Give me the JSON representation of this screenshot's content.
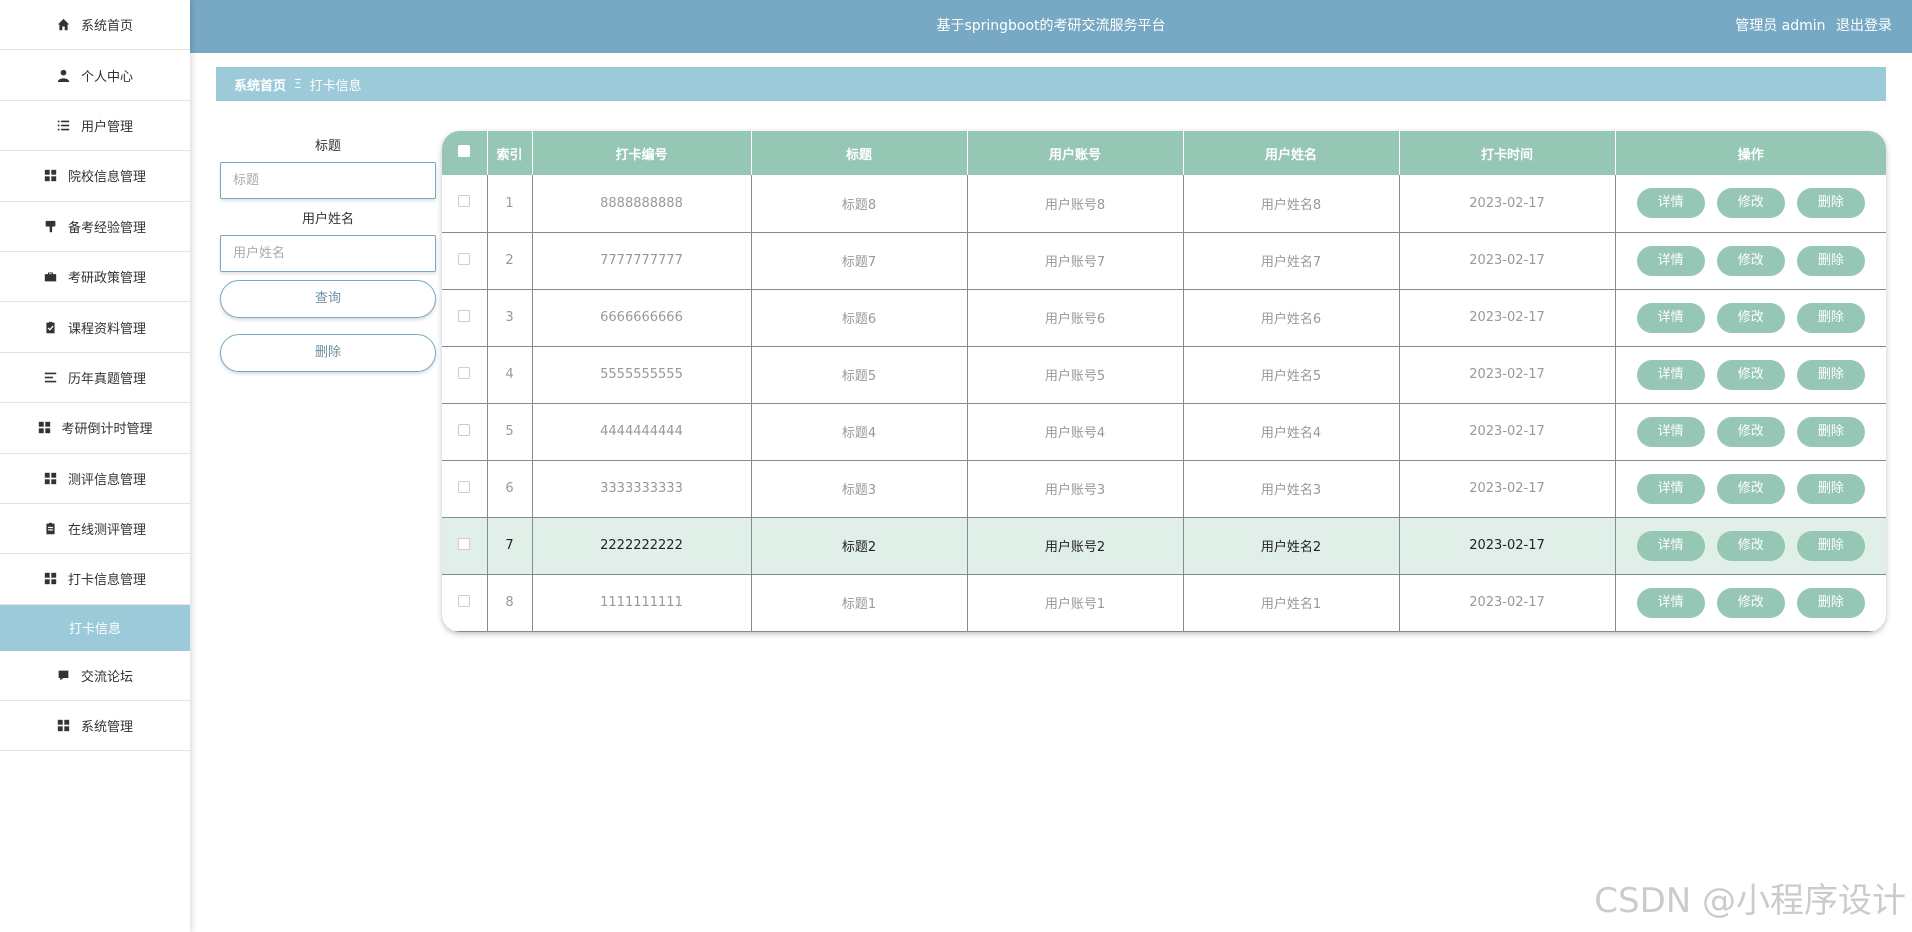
{
  "sidebar": {
    "items": [
      {
        "label": "系统首页",
        "icon": "home-icon"
      },
      {
        "label": "个人中心",
        "icon": "user-icon"
      },
      {
        "label": "用户管理",
        "icon": "list-icon"
      },
      {
        "label": "院校信息管理",
        "icon": "grid-icon"
      },
      {
        "label": "备考经验管理",
        "icon": "brush-icon"
      },
      {
        "label": "考研政策管理",
        "icon": "briefcase-icon"
      },
      {
        "label": "课程资料管理",
        "icon": "clipboard-check-icon"
      },
      {
        "label": "历年真题管理",
        "icon": "align-left-icon"
      },
      {
        "label": "考研倒计时管理",
        "icon": "grid-icon"
      },
      {
        "label": "测评信息管理",
        "icon": "grid-icon"
      },
      {
        "label": "在线测评管理",
        "icon": "clipboard-icon"
      },
      {
        "label": "打卡信息管理",
        "icon": "grid-icon"
      },
      {
        "label": "打卡信息",
        "icon": ""
      },
      {
        "label": "交流论坛",
        "icon": "chat-icon"
      },
      {
        "label": "系统管理",
        "icon": "grid-icon"
      }
    ]
  },
  "header": {
    "title": "基于springboot的考研交流服务平台",
    "role": "管理员 admin",
    "logout": "退出登录"
  },
  "breadcrumb": {
    "home": "系统首页",
    "separator": "Ξ",
    "current": "打卡信息"
  },
  "search": {
    "title_label": "标题",
    "title_placeholder": "标题",
    "name_label": "用户姓名",
    "name_placeholder": "用户姓名",
    "query_button": "查询",
    "delete_button": "删除"
  },
  "table": {
    "headers": [
      "索引",
      "打卡编号",
      "标题",
      "用户账号",
      "用户姓名",
      "打卡时间",
      "操作"
    ],
    "rows": [
      {
        "index": "1",
        "code": "8888888888",
        "title": "标题8",
        "account": "用户账号8",
        "name": "用户姓名8",
        "time": "2023-02-17"
      },
      {
        "index": "2",
        "code": "7777777777",
        "title": "标题7",
        "account": "用户账号7",
        "name": "用户姓名7",
        "time": "2023-02-17"
      },
      {
        "index": "3",
        "code": "6666666666",
        "title": "标题6",
        "account": "用户账号6",
        "name": "用户姓名6",
        "time": "2023-02-17"
      },
      {
        "index": "4",
        "code": "5555555555",
        "title": "标题5",
        "account": "用户账号5",
        "name": "用户姓名5",
        "time": "2023-02-17"
      },
      {
        "index": "5",
        "code": "4444444444",
        "title": "标题4",
        "account": "用户账号4",
        "name": "用户姓名4",
        "time": "2023-02-17"
      },
      {
        "index": "6",
        "code": "3333333333",
        "title": "标题3",
        "account": "用户账号3",
        "name": "用户姓名3",
        "time": "2023-02-17"
      },
      {
        "index": "7",
        "code": "2222222222",
        "title": "标题2",
        "account": "用户账号2",
        "name": "用户姓名2",
        "time": "2023-02-17"
      },
      {
        "index": "8",
        "code": "1111111111",
        "title": "标题1",
        "account": "用户账号1",
        "name": "用户姓名1",
        "time": "2023-02-17"
      }
    ],
    "actions": {
      "detail": "详情",
      "edit": "修改",
      "delete": "删除"
    }
  },
  "watermark": "CSDN @小程序设计",
  "colors": {
    "header": "#77a9c4",
    "breadcrumb": "#9ccad8",
    "table_header": "#96c6b4",
    "highlight_row": "#e1efe9"
  }
}
